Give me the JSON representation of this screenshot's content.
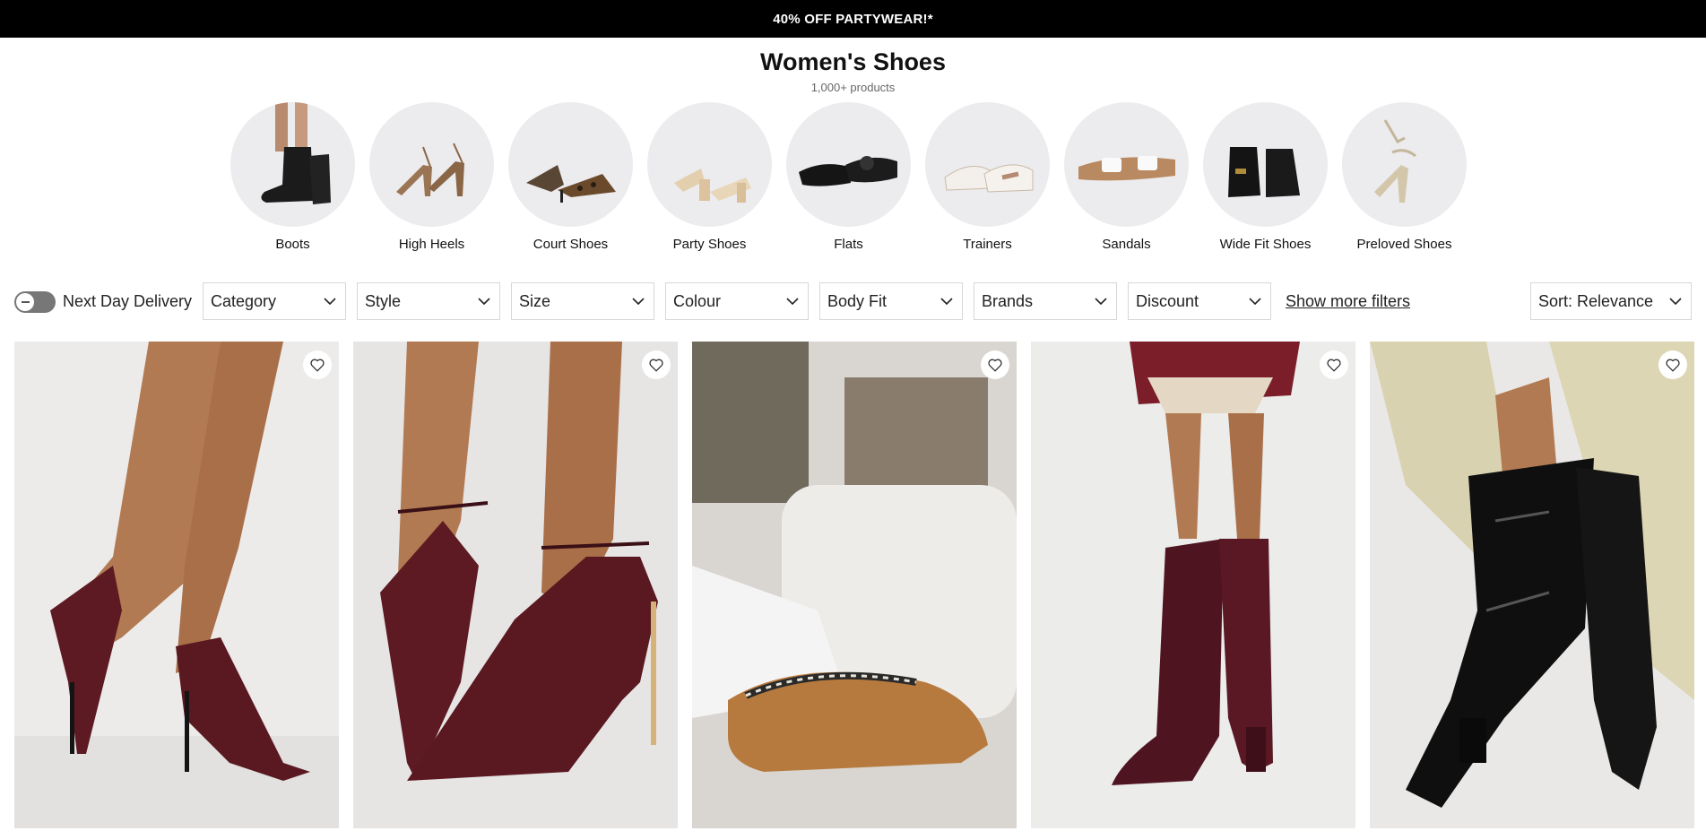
{
  "promo": {
    "text": "40% OFF PARTYWEAR!*"
  },
  "header": {
    "title": "Women's Shoes",
    "count": "1,000+ products"
  },
  "categories": [
    {
      "label": "Boots",
      "icon": "boots-thumbnail"
    },
    {
      "label": "High Heels",
      "icon": "high-heels-thumbnail"
    },
    {
      "label": "Court Shoes",
      "icon": "court-shoes-thumbnail"
    },
    {
      "label": "Party Shoes",
      "icon": "party-shoes-thumbnail"
    },
    {
      "label": "Flats",
      "icon": "flats-thumbnail"
    },
    {
      "label": "Trainers",
      "icon": "trainers-thumbnail"
    },
    {
      "label": "Sandals",
      "icon": "sandals-thumbnail"
    },
    {
      "label": "Wide Fit Shoes",
      "icon": "wide-fit-shoes-thumbnail"
    },
    {
      "label": "Preloved Shoes",
      "icon": "preloved-shoes-thumbnail"
    }
  ],
  "filters": {
    "next_day_label": "Next Day Delivery",
    "next_day_on": false,
    "dropdowns": [
      "Category",
      "Style",
      "Size",
      "Colour",
      "Body Fit",
      "Brands",
      "Discount"
    ],
    "show_more": "Show more filters",
    "sort": "Sort: Relevance"
  },
  "products": [
    {
      "image": "burgundy-slingback-heels"
    },
    {
      "image": "burgundy-ankle-strap-heels"
    },
    {
      "image": "tan-suede-slippers"
    },
    {
      "image": "burgundy-patent-knee-boots"
    },
    {
      "image": "black-patent-knee-boots"
    }
  ],
  "colors": {
    "promo_bg": "#000000",
    "accent_burgundy": "#5e1a22",
    "circle_bg": "#ecebed"
  }
}
